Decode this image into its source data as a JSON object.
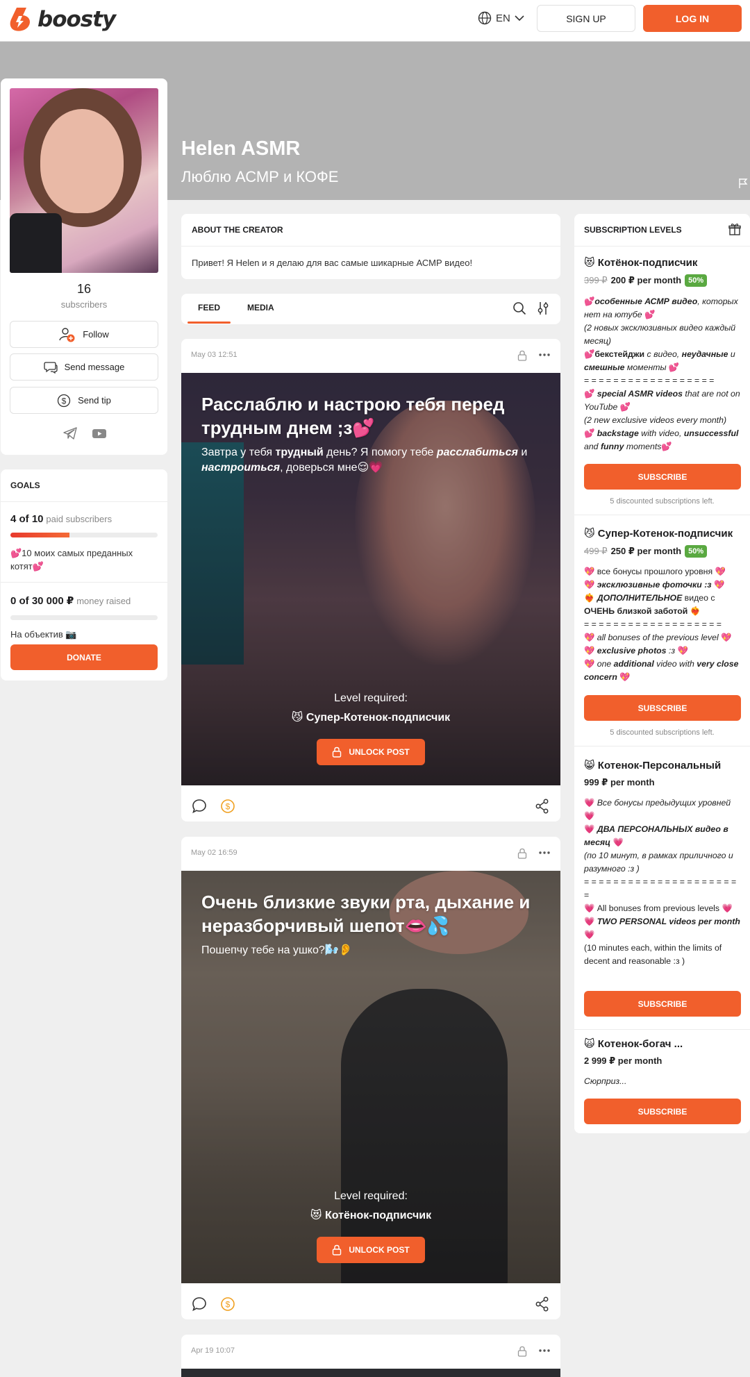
{
  "header": {
    "logo_text": "boosty",
    "language": "EN",
    "signup_label": "SIGN UP",
    "login_label": "LOG IN"
  },
  "cover": {
    "name": "Helen ASMR",
    "tagline": "Люблю АСМР и КОФЕ"
  },
  "profile": {
    "subscribers_count": "16",
    "subscribers_label": "subscribers",
    "follow_label": "Follow",
    "message_label": "Send message",
    "tip_label": "Send tip"
  },
  "goals": {
    "title": "GOALS",
    "goal1": {
      "progress": "4 of 10",
      "unit": "paid subscribers",
      "fraction": 0.4,
      "description": "💕10 моих самых преданных котят💕"
    },
    "goal2": {
      "progress": "0 of 30 000 ₽",
      "unit": "money raised",
      "fraction": 0,
      "description": "На объектив 📷"
    },
    "donate_label": "DONATE"
  },
  "about": {
    "title": "ABOUT THE CREATOR",
    "text": "Привет! Я Helen и я делаю для вас самые шикарные АСМР видео!"
  },
  "tabs": [
    "FEED",
    "MEDIA"
  ],
  "posts": [
    {
      "date": "May 03 12:51",
      "title": "Расслаблю и настрою тебя перед трудным днем ;з💕",
      "subtitle_parts": [
        "Завтра у тебя ",
        "трудный",
        " день? Я помогу тебе ",
        "расслабиться",
        " и ",
        "настроиться",
        ", доверься мне😌💗"
      ],
      "level_required_label": "Level required:",
      "level_name": "😼 Супер-Котенок-подписчик",
      "unlock_label": "UNLOCK POST"
    },
    {
      "date": "May 02 16:59",
      "title": "Очень близкие звуки рта, дыхание и неразборчивый шепот👄💦",
      "subtitle": "Пошепчу тебе на ушко?🌬️👂",
      "level_required_label": "Level required:",
      "level_name": "😻 Котёнок-подписчик",
      "unlock_label": "UNLOCK POST"
    },
    {
      "date": "Apr 19 10:07"
    }
  ],
  "levels": {
    "title": "SUBSCRIPTION LEVELS",
    "subscribe_label": "SUBSCRIBE",
    "items": [
      {
        "name": "😻 Котёнок-подписчик",
        "old_price": "399 ₽",
        "price": "200 ₽ per month",
        "badge": "50%",
        "discount_note": "5 discounted subscriptions left."
      },
      {
        "name": "😼 Супер-Котенок-подписчик",
        "old_price": "499 ₽",
        "price": "250 ₽ per month",
        "badge": "50%",
        "discount_note": "5 discounted subscriptions left."
      },
      {
        "name": "😸 Котенок-Персональный",
        "price": "999 ₽ per month"
      },
      {
        "name": "🙀 Котенок-богач ...",
        "price": "2 999 ₽ per month",
        "desc": "Сюрприз..."
      }
    ]
  },
  "colors": {
    "accent": "#f15f2c",
    "badge_green": "#5aa941",
    "cover_gray": "#b3b3b3"
  }
}
